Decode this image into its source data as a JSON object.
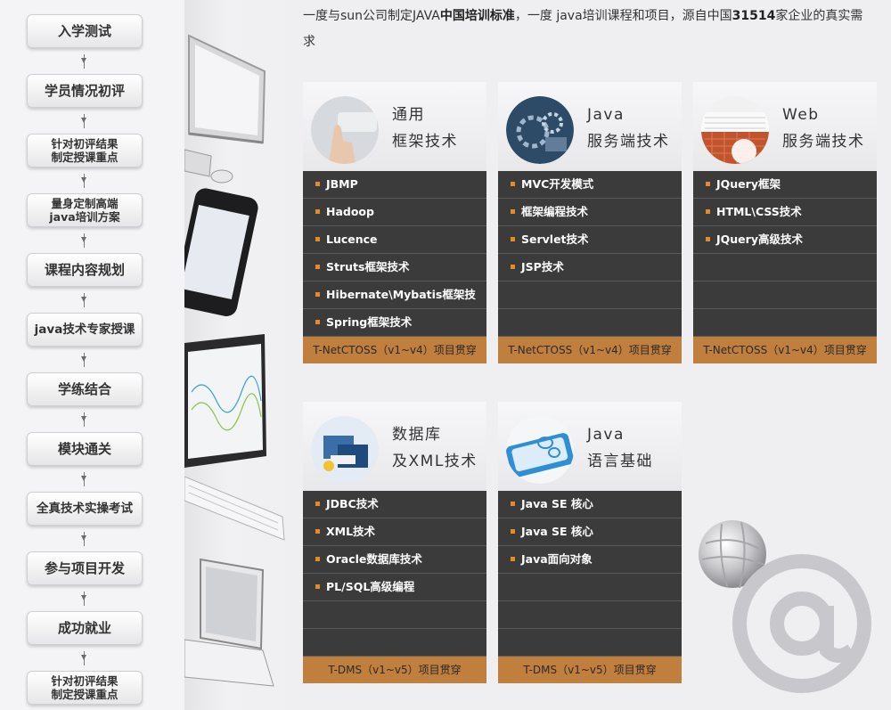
{
  "flow_steps": [
    "入学测试",
    "学员情况初评",
    "针对初评结果\n制定授课重点",
    "量身定制高端\njava培训方案",
    "课程内容规划",
    "java技术专家授课",
    "学练结合",
    "模块通关",
    "全真技术实操考试",
    "参与项目开发",
    "成功就业",
    "针对初评结果\n制定授课重点"
  ],
  "intro": {
    "p1": "一度与sun公司制定JAVA",
    "p1_bold": "中国培训标准",
    "p2": "，一度 java培训课程和项目，源自中国",
    "p2_bold": "31514",
    "p3": "家企业的真实需求"
  },
  "cards": [
    {
      "title": "通用\n框架技术",
      "items": [
        "JBMP",
        "Hadoop",
        "Lucence",
        "Struts框架技术",
        "Hibernate\\Mybatis框架技术",
        "Spring框架技术"
      ],
      "footer": "T-NetCTOSS（v1~v4）项目贯穿"
    },
    {
      "title": "Java\n服务端技术",
      "items": [
        "MVC开发模式",
        "框架编程技术",
        "Servlet技术",
        "JSP技术",
        "",
        ""
      ],
      "footer": "T-NetCTOSS（v1~v4）项目贯穿"
    },
    {
      "title": "Web\n服务端技术",
      "items": [
        "JQuery框架",
        "HTML\\CSS技术",
        "JQuery高级技术",
        "",
        "",
        ""
      ],
      "footer": "T-NetCTOSS（v1~v4）项目贯穿"
    },
    {
      "title": "数据库\n及XML技术",
      "items": [
        "JDBC技术",
        "XML技术",
        "Oracle数据库技术",
        "PL/SQL高级编程",
        "",
        ""
      ],
      "footer": "T-DMS（v1~v5）项目贯穿"
    },
    {
      "title": "Java\n语言基础",
      "items": [
        "Java SE 核心",
        "Java SE 核心",
        "Java面向对象",
        "",
        "",
        ""
      ],
      "footer": "T-DMS（v1~v5）项目贯穿"
    }
  ],
  "colors": {
    "list_bg": "#3c3b3b",
    "bullet": "#e58a2a",
    "footer_bg": "#c07f3d"
  }
}
